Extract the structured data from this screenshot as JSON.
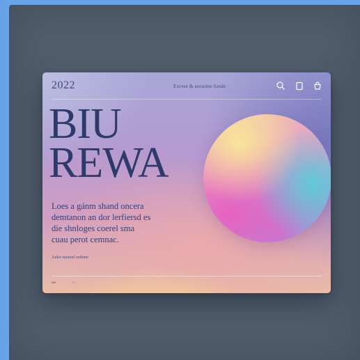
{
  "card": {
    "year": "2022",
    "tagline": "Excese & aocuime liasde",
    "headline": {
      "line1": "BIU",
      "line2": "REWA"
    },
    "body": {
      "line1": "Loes a gánm shand oncera",
      "line2": "demtanon an dor lerfiersd es",
      "line3": "die shnloges coerel sma",
      "line4": "cuau perot cemnac."
    },
    "caption": "Aeko reereel ordone",
    "footer": {
      "left": "ase",
      "dash": "—"
    },
    "icons": [
      "search-icon",
      "clipboard-icon",
      "bag-icon"
    ]
  },
  "colors": {
    "outer_frame": "#6aa2ea",
    "panel": "#525e6c",
    "headline_text": "#2f3a6c"
  }
}
